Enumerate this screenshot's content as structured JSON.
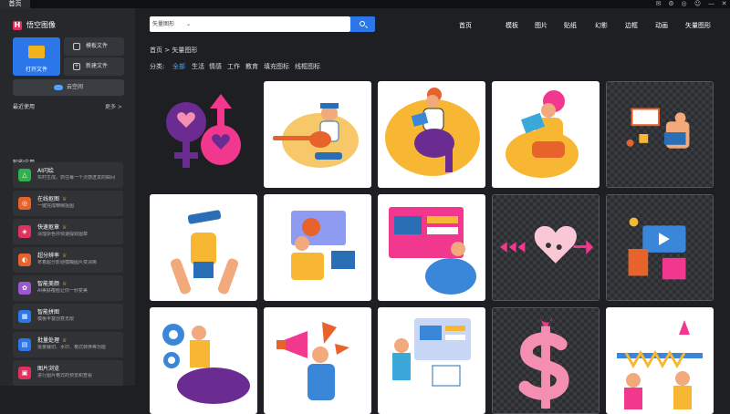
{
  "window": {
    "tab_label": "首页",
    "controls": [
      "✉",
      "⚙",
      "◎",
      "☺",
      "—",
      "✕"
    ]
  },
  "sidebar": {
    "logo_letter": "H",
    "app_name": "悟空图像",
    "open_file": "打开文件",
    "template_file": "模板文件",
    "new_file": "新建文件",
    "cloud": "云空间",
    "recent_title": "最近使用",
    "more": "更多 >",
    "smart_title": "智能应用",
    "apps": [
      {
        "title": "AI闪绘",
        "sub": "实时生成，抓住每一个灵感迸发的瞬间",
        "icon": "△",
        "color": "#2fb24c",
        "crown": false
      },
      {
        "title": "在线抠图",
        "sub": "一键完成精细抠图",
        "icon": "◎",
        "color": "#e8622b",
        "crown": true
      },
      {
        "title": "快速抠章",
        "sub": "清理杂色并快速提取图章",
        "icon": "◈",
        "color": "#e0325f",
        "crown": true
      },
      {
        "title": "超分辨率",
        "sub": "拿着超分影便模糊图片变清晰",
        "icon": "◐",
        "color": "#e8622b",
        "crown": true
      },
      {
        "title": "智能美颜",
        "sub": "AI美肤瘦脸让你一秒变美",
        "icon": "✿",
        "color": "#9b59d0",
        "crown": true
      },
      {
        "title": "智能拼图",
        "sub": "模板丰富创意无限",
        "icon": "▦",
        "color": "#2b76e8",
        "crown": false
      },
      {
        "title": "批量处理",
        "sub": "批量裁切、水印、格式转换等功能",
        "icon": "▤",
        "color": "#2b76e8",
        "crown": true
      },
      {
        "title": "图片浏览",
        "sub": "进行图片格式的预览和查看",
        "icon": "▣",
        "color": "#e0325f",
        "crown": false
      }
    ],
    "crown_glyph": "♕"
  },
  "search": {
    "keyword": "矢量图形",
    "dropdown": "⌄"
  },
  "topnav": [
    "首页",
    "模板",
    "图片",
    "贴纸",
    "幻影",
    "边框",
    "动画",
    "矢量图形"
  ],
  "breadcrumb": {
    "home": "首页",
    "sep": ">",
    "current": "矢量图形"
  },
  "categories": {
    "label": "分类:",
    "items": [
      "全部",
      "生活",
      "情感",
      "工作",
      "教育",
      "填充图标",
      "线框图标"
    ],
    "active_index": 0
  },
  "colors": {
    "accent": "#2b76e8",
    "active_category": "#4da3ff",
    "pink": "#f2378f",
    "orange": "#f7b733",
    "purple": "#6b2c91"
  },
  "gallery": [
    {
      "name": "gender-symbols",
      "bg": "checker"
    },
    {
      "name": "guitar-player",
      "bg": "white"
    },
    {
      "name": "laptop-man",
      "bg": "white"
    },
    {
      "name": "reading-woman",
      "bg": "white"
    },
    {
      "name": "home-tv",
      "bg": "checker"
    },
    {
      "name": "telescope-climbers",
      "bg": "white"
    },
    {
      "name": "online-learning",
      "bg": "white"
    },
    {
      "name": "web-design",
      "bg": "white"
    },
    {
      "name": "heart-arrow",
      "bg": "checker"
    },
    {
      "name": "online-shopping",
      "bg": "checker"
    },
    {
      "name": "gear-workers",
      "bg": "white"
    },
    {
      "name": "megaphone-woman",
      "bg": "white"
    },
    {
      "name": "browser-collab",
      "bg": "white"
    },
    {
      "name": "dollar-sign",
      "bg": "checker"
    },
    {
      "name": "party-people",
      "bg": "white"
    }
  ]
}
